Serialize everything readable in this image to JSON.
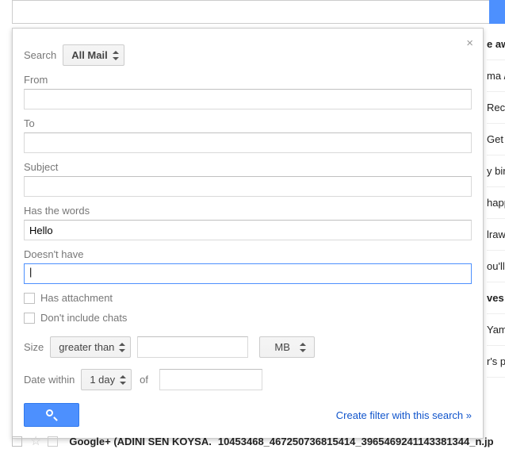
{
  "search": {
    "label": "Search",
    "scope_selected": "All Mail",
    "from_label": "From",
    "from_value": "",
    "to_label": "To",
    "to_value": "",
    "subject_label": "Subject",
    "subject_value": "",
    "haswords_label": "Has the words",
    "haswords_value": "Hello",
    "doesnthave_label": "Doesn't have",
    "doesnthave_value": "",
    "has_attachment_label": "Has attachment",
    "dont_include_chats_label": "Don't include chats",
    "size_label": "Size",
    "size_op_selected": "greater than",
    "size_value": "",
    "size_unit_selected": "MB",
    "datewithin_label": "Date within",
    "datewithin_selected": "1 day",
    "of_label": "of",
    "date_value": "",
    "filter_link": "Create filter with this search »"
  },
  "bg": {
    "r1": "e aw",
    "r2": "ma /",
    "r3": "Rec",
    "r4": "Get",
    "r5": "y birt",
    "r6": "happ",
    "r7": "lrawa",
    "r8": "ou'll l",
    "r9": "ves",
    "r10": "Yam",
    "r11": "r's p"
  },
  "msg": {
    "sender": "Google+ (ADINI SEN KOYSA.",
    "subject": "10453468_467250736815414_3965469241143381344_n.jp"
  }
}
